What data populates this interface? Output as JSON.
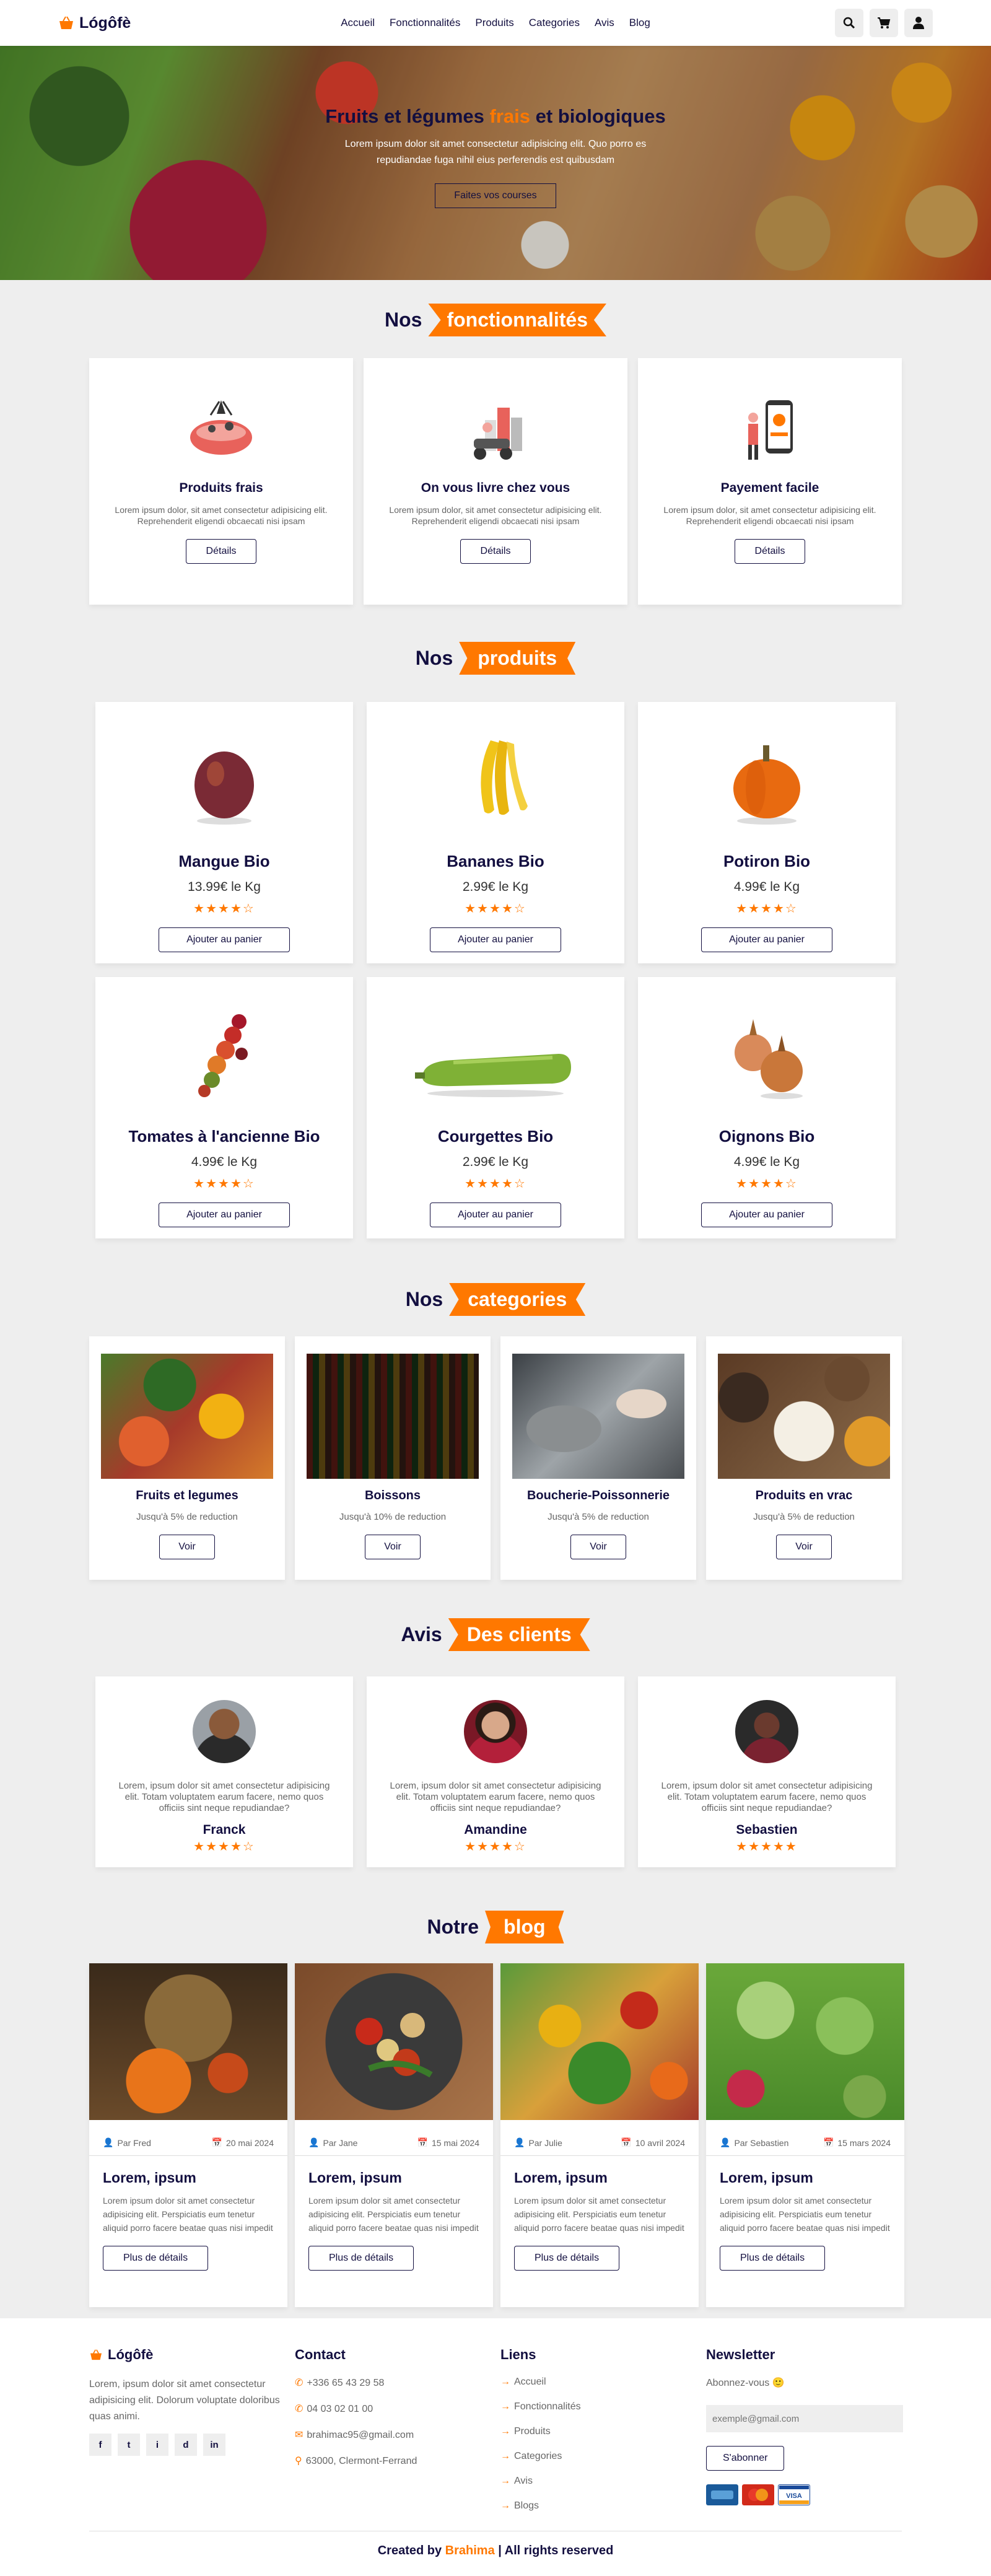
{
  "header": {
    "logo": "Lógôfè",
    "nav": [
      "Accueil",
      "Fonctionnalités",
      "Produits",
      "Categories",
      "Avis",
      "Blog"
    ]
  },
  "hero": {
    "title_part1": "Fruits et légumes ",
    "title_accent": "frais",
    "title_part2": " et biologiques",
    "text": "Lorem ipsum dolor sit amet consectetur adipisicing elit. Quo porro es repudiandae fuga nihil eius perferendis est quibusdam",
    "button": "Faites vos courses"
  },
  "features": {
    "title_plain": "Nos",
    "title_accent": "fonctionnalités",
    "items": [
      {
        "title": "Produits frais",
        "text": "Lorem ipsum dolor, sit amet consectetur adipisicing elit. Reprehenderit eligendi obcaecati nisi ipsam",
        "button": "Détails"
      },
      {
        "title": "On vous livre chez vous",
        "text": "Lorem ipsum dolor, sit amet consectetur adipisicing elit. Reprehenderit eligendi obcaecati nisi ipsam",
        "button": "Détails"
      },
      {
        "title": "Payement facile",
        "text": "Lorem ipsum dolor, sit amet consectetur adipisicing elit. Reprehenderit eligendi obcaecati nisi ipsam",
        "button": "Détails"
      }
    ]
  },
  "products": {
    "title_plain": "Nos",
    "title_accent": "produits",
    "items": [
      {
        "name": "Mangue Bio",
        "price": "13.99€ le Kg",
        "stars": "★★★★☆",
        "button": "Ajouter au panier"
      },
      {
        "name": "Bananes Bio",
        "price": "2.99€ le Kg",
        "stars": "★★★★☆",
        "button": "Ajouter au panier"
      },
      {
        "name": "Potiron Bio",
        "price": "4.99€ le Kg",
        "stars": "★★★★☆",
        "button": "Ajouter au panier"
      },
      {
        "name": "Tomates à l'ancienne Bio",
        "price": "4.99€ le Kg",
        "stars": "★★★★☆",
        "button": "Ajouter au panier"
      },
      {
        "name": "Courgettes Bio",
        "price": "2.99€ le Kg",
        "stars": "★★★★☆",
        "button": "Ajouter au panier"
      },
      {
        "name": "Oignons Bio",
        "price": "4.99€ le Kg",
        "stars": "★★★★☆",
        "button": "Ajouter au panier"
      }
    ]
  },
  "categories": {
    "title_plain": "Nos",
    "title_accent": "categories",
    "items": [
      {
        "name": "Fruits et legumes",
        "discount": "Jusqu'à 5% de reduction",
        "button": "Voir"
      },
      {
        "name": "Boissons",
        "discount": "Jusqu'à 10% de reduction",
        "button": "Voir"
      },
      {
        "name": "Boucherie-Poissonnerie",
        "discount": "Jusqu'à 5% de reduction",
        "button": "Voir"
      },
      {
        "name": "Produits en vrac",
        "discount": "Jusqu'à 5% de reduction",
        "button": "Voir"
      }
    ]
  },
  "reviews": {
    "title_plain": "Avis",
    "title_accent": "Des clients",
    "items": [
      {
        "text": "Lorem, ipsum dolor sit amet consectetur adipisicing elit. Totam voluptatem earum facere, nemo quos officiis sint neque repudiandae?",
        "name": "Franck",
        "stars": "★★★★☆"
      },
      {
        "text": "Lorem, ipsum dolor sit amet consectetur adipisicing elit. Totam voluptatem earum facere, nemo quos officiis sint neque repudiandae?",
        "name": "Amandine",
        "stars": "★★★★☆"
      },
      {
        "text": "Lorem, ipsum dolor sit amet consectetur adipisicing elit. Totam voluptatem earum facere, nemo quos officiis sint neque repudiandae?",
        "name": "Sebastien",
        "stars": "★★★★★"
      }
    ]
  },
  "blog": {
    "title_plain": "Notre",
    "title_accent": "blog",
    "items": [
      {
        "author": "Par Fred",
        "date": "20 mai 2024",
        "title": "Lorem, ipsum",
        "text": "Lorem ipsum dolor sit amet consectetur adipisicing elit. Perspiciatis eum tenetur aliquid porro facere beatae quas nisi impedit",
        "button": "Plus de détails"
      },
      {
        "author": "Par Jane",
        "date": "15 mai 2024",
        "title": "Lorem, ipsum",
        "text": "Lorem ipsum dolor sit amet consectetur adipisicing elit. Perspiciatis eum tenetur aliquid porro facere beatae quas nisi impedit",
        "button": "Plus de détails"
      },
      {
        "author": "Par Julie",
        "date": "10 avril 2024",
        "title": "Lorem, ipsum",
        "text": "Lorem ipsum dolor sit amet consectetur adipisicing elit. Perspiciatis eum tenetur aliquid porro facere beatae quas nisi impedit",
        "button": "Plus de détails"
      },
      {
        "author": "Par Sebastien",
        "date": "15 mars 2024",
        "title": "Lorem, ipsum",
        "text": "Lorem ipsum dolor sit amet consectetur adipisicing elit. Perspiciatis eum tenetur aliquid porro facere beatae quas nisi impedit",
        "button": "Plus de détails"
      }
    ]
  },
  "footer": {
    "logo": "Lógôfè",
    "about": "Lorem, ipsum dolor sit amet consectetur adipisicing elit. Dolorum voluptate doloribus quas animi.",
    "socials": [
      "f",
      "t",
      "i",
      "d",
      "in"
    ],
    "contact_title": "Contact",
    "contact": [
      "+336 65 43 29 58",
      "04 03 02 01 00",
      "brahimac95@gmail.com",
      "63000, Clermont-Ferrand"
    ],
    "links_title": "Liens",
    "links": [
      "Accueil",
      "Fonctionnalités",
      "Produits",
      "Categories",
      "Avis",
      "Blogs"
    ],
    "newsletter_title": "Newsletter",
    "newsletter_text": "Abonnez-vous 🙂",
    "email_placeholder": "exemple@gmail.com",
    "subscribe": "S'abonner",
    "credit_pre": "Created by ",
    "credit_name": "Brahima",
    "credit_post": " | All rights reserved"
  },
  "colors": {
    "accent": "#ff7800",
    "dark": "#130f40",
    "bg": "#eeeeee"
  }
}
